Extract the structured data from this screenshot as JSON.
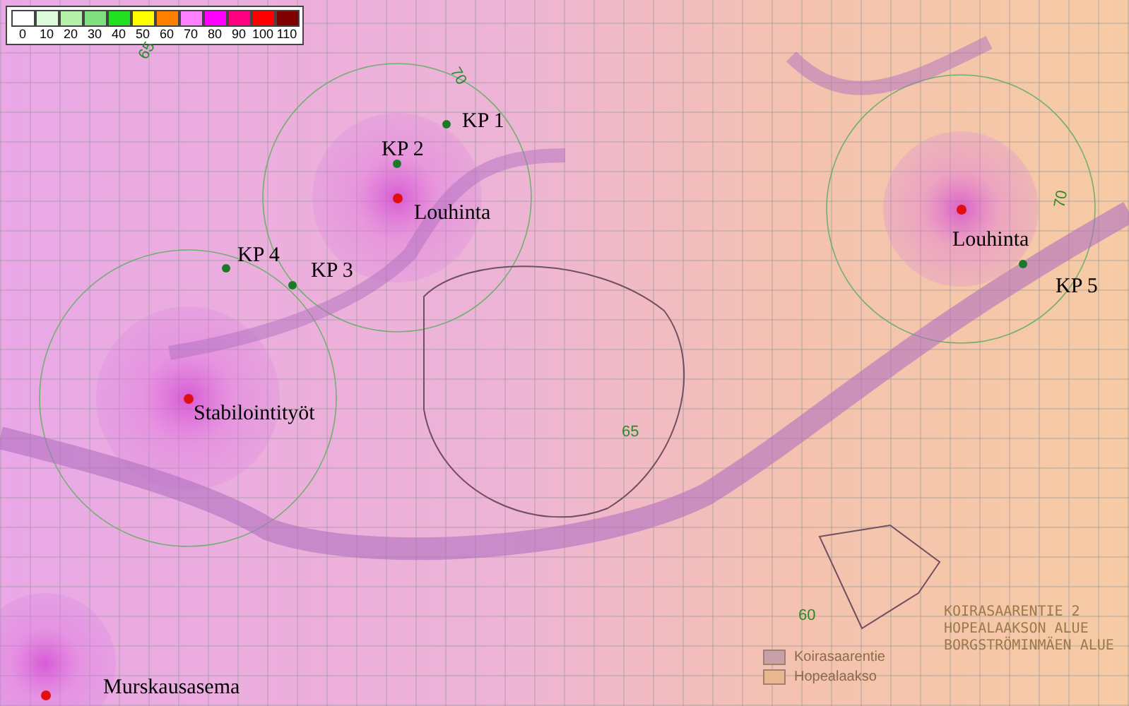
{
  "legend": {
    "bins": [
      {
        "label": "0",
        "color": "#ffffff"
      },
      {
        "label": "10",
        "color": "#ddfadd"
      },
      {
        "label": "20",
        "color": "#b4f0a8"
      },
      {
        "label": "30",
        "color": "#80e080"
      },
      {
        "label": "40",
        "color": "#20e020"
      },
      {
        "label": "50",
        "color": "#ffff00"
      },
      {
        "label": "60",
        "color": "#ff8000"
      },
      {
        "label": "70",
        "color": "#ff80ff"
      },
      {
        "label": "80",
        "color": "#ff00ff"
      },
      {
        "label": "90",
        "color": "#ff0080"
      },
      {
        "label": "100",
        "color": "#ff0000"
      },
      {
        "label": "110",
        "color": "#800000"
      }
    ]
  },
  "noise_sources": [
    {
      "label": "Louhinta"
    },
    {
      "label": "Louhinta"
    },
    {
      "label": "Stabilointityöt"
    },
    {
      "label": "Murskausasema"
    }
  ],
  "measurement_points": [
    {
      "label": "KP 1"
    },
    {
      "label": "KP 2"
    },
    {
      "label": "KP 3"
    },
    {
      "label": "KP 4"
    },
    {
      "label": "KP 5"
    }
  ],
  "contour_labels": [
    "65",
    "70",
    "65",
    "70",
    "60"
  ],
  "plan_title": [
    "KOIRASAARENTIE 2",
    "HOPEALAAKSON ALUE",
    "BORGSTRÖMINMÄEN ALUE"
  ],
  "plan_key": [
    {
      "label": "Koirasaarentie",
      "color": "#c8a0a8"
    },
    {
      "label": "Hopealaakso",
      "color": "#e8b890"
    }
  ]
}
